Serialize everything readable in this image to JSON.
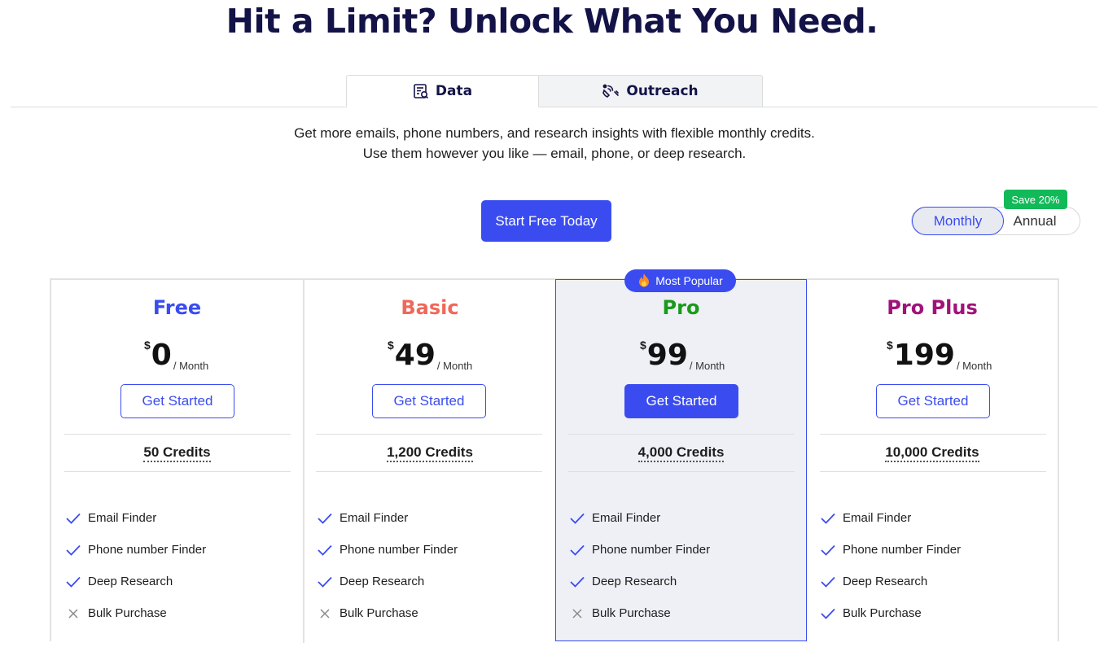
{
  "header": {
    "title": "Hit a Limit? Unlock What You Need."
  },
  "tabs": [
    {
      "label": "Data",
      "icon": "data-report-icon",
      "active": true
    },
    {
      "label": "Outreach",
      "icon": "outreach-signal-icon",
      "active": false
    }
  ],
  "intro": {
    "line1": "Get more emails, phone numbers, and research insights with flexible monthly credits.",
    "line2": "Use them however you like — email, phone, or deep research."
  },
  "cta": {
    "label": "Start Free Today"
  },
  "billing": {
    "monthly": "Monthly",
    "annual": "Annual",
    "save_badge": "Save 20%",
    "selected": "Monthly"
  },
  "popular_badge": {
    "label": "Most Popular",
    "icon": "fire-icon"
  },
  "colors": {
    "accent": "#3a4cf0",
    "free": "#3a4cf0",
    "basic": "#f0685a",
    "pro": "#1a9a1a",
    "proplus": "#a0127a",
    "save": "#12b959"
  },
  "plans": [
    {
      "name": "Free",
      "currency": "$",
      "price": "0",
      "period": "/ Month",
      "button": "Get Started",
      "credits": "50 Credits",
      "features": [
        {
          "label": "Email Finder",
          "included": true
        },
        {
          "label": "Phone number Finder",
          "included": true
        },
        {
          "label": "Deep Research",
          "included": true
        },
        {
          "label": "Bulk Purchase",
          "included": false
        }
      ]
    },
    {
      "name": "Basic",
      "currency": "$",
      "price": "49",
      "period": "/ Month",
      "button": "Get Started",
      "credits": "1,200 Credits",
      "features": [
        {
          "label": "Email Finder",
          "included": true
        },
        {
          "label": "Phone number Finder",
          "included": true
        },
        {
          "label": "Deep Research",
          "included": true
        },
        {
          "label": "Bulk Purchase",
          "included": false
        }
      ]
    },
    {
      "name": "Pro",
      "currency": "$",
      "price": "99",
      "period": "/ Month",
      "button": "Get Started",
      "credits": "4,000 Credits",
      "features": [
        {
          "label": "Email Finder",
          "included": true
        },
        {
          "label": "Phone number Finder",
          "included": true
        },
        {
          "label": "Deep Research",
          "included": true
        },
        {
          "label": "Bulk Purchase",
          "included": false
        }
      ]
    },
    {
      "name": "Pro Plus",
      "currency": "$",
      "price": "199",
      "period": "/ Month",
      "button": "Get Started",
      "credits": "10,000 Credits",
      "features": [
        {
          "label": "Email Finder",
          "included": true
        },
        {
          "label": "Phone number Finder",
          "included": true
        },
        {
          "label": "Deep Research",
          "included": true
        },
        {
          "label": "Bulk Purchase",
          "included": true
        }
      ]
    }
  ]
}
